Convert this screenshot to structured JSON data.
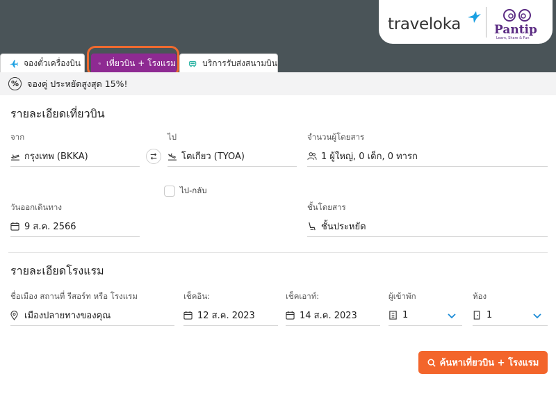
{
  "brand": {
    "traveloka": "traveloka",
    "pantip": "Pantip",
    "pantip_tagline": "Learn, Share & Fun"
  },
  "tabs": [
    {
      "label": "จองตั๋วเครื่องบิน",
      "icon": "airplane-icon",
      "active": false
    },
    {
      "label": "เที่ยวบิน + โรงแรม",
      "icon": "flight-hotel-icon",
      "active": true
    },
    {
      "label": "บริการรับส่งสนามบิน",
      "icon": "car-icon",
      "active": false
    }
  ],
  "promo": {
    "text": "จองคู่ ประหยัดสูงสุด 15%!",
    "icon": "percent-icon"
  },
  "flight": {
    "title": "รายละเอียดเที่ยวบิน",
    "from_label": "จาก",
    "from_value": "กรุงเทพ (BKKA)",
    "to_label": "ไป",
    "to_value": "โตเกียว (TYOA)",
    "passengers_label": "จำนวนผู้โดยสาร",
    "passengers_value": "1 ผู้ใหญ่, 0 เด็ก, 0 ทารก",
    "roundtrip_label": "ไป-กลับ",
    "depart_label": "วันออกเดินทาง",
    "depart_value": "9 ส.ค. 2566",
    "class_label": "ชั้นโดยสาร",
    "class_value": "ชั้นประหยัด"
  },
  "hotel": {
    "title": "รายละเอียดโรงแรม",
    "destination_label": "ชื่อเมือง สถานที่ รีสอร์ท หรือ โรงแรม",
    "destination_value": "เมืองปลายทางของคุณ",
    "checkin_label": "เช็คอิน:",
    "checkin_value": "12 ส.ค. 2023",
    "checkout_label": "เช็คเอาท์:",
    "checkout_value": "14 ส.ค. 2023",
    "guests_label": "ผู้เข้าพัก",
    "guests_value": "1",
    "rooms_label": "ห้อง",
    "rooms_value": "1"
  },
  "search_button": "ค้นหาเที่ยวบิน + โรงแรม",
  "colors": {
    "header_bg": "#4a5458",
    "active_tab": "#8e2a92",
    "accent": "#f3652b",
    "traveloka_blue": "#1ba0e2",
    "pantip_purple": "#5a2a82"
  }
}
